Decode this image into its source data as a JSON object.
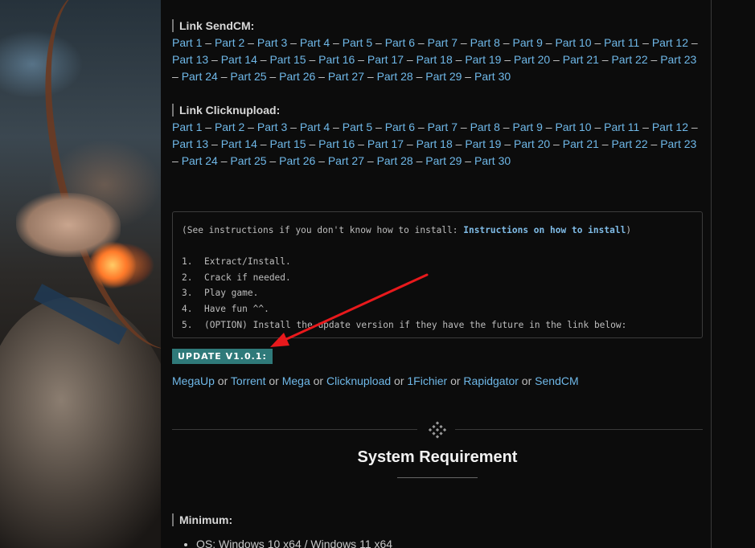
{
  "sendcm": {
    "label": "Link SendCM:",
    "parts": [
      "Part 1",
      "Part 2",
      "Part 3",
      "Part 4",
      "Part 5",
      "Part 6",
      "Part 7",
      "Part 8",
      "Part 9",
      "Part 10",
      "Part 11",
      "Part 12",
      "Part 13",
      "Part 14",
      "Part 15",
      "Part 16",
      "Part 17",
      "Part 18",
      "Part 19",
      "Part 20",
      "Part 21",
      "Part 22",
      "Part 23",
      "Part 24",
      "Part 25",
      "Part 26",
      "Part 27",
      "Part 28",
      "Part 29",
      "Part 30"
    ]
  },
  "clicknupload": {
    "label": "Link Clicknupload:",
    "parts": [
      "Part 1",
      "Part 2",
      "Part 3",
      "Part 4",
      "Part 5",
      "Part 6",
      "Part 7",
      "Part 8",
      "Part 9",
      "Part 10",
      "Part 11",
      "Part 12",
      "Part 13",
      "Part 14",
      "Part 15",
      "Part 16",
      "Part 17",
      "Part 18",
      "Part 19",
      "Part 20",
      "Part 21",
      "Part 22",
      "Part 23",
      "Part 24",
      "Part 25",
      "Part 26",
      "Part 27",
      "Part 28",
      "Part 29",
      "Part 30"
    ]
  },
  "separator": " – ",
  "install": {
    "intro_prefix": "(See instructions if you don't know how to install: ",
    "intro_link": "Instructions on how to install",
    "intro_suffix": ")",
    "steps": [
      {
        "num": "1.",
        "text": "Extract/Install."
      },
      {
        "num": "2.",
        "text": "Crack if needed."
      },
      {
        "num": "3.",
        "text": "Play game."
      },
      {
        "num": "4.",
        "text": "Have fun ^^."
      },
      {
        "num": "5.",
        "text": "(OPTION) Install the update version if they have the future in the link below:"
      }
    ]
  },
  "update": {
    "badge": "UPDATE V1.0.1:",
    "mirrors": [
      "MegaUp",
      "Torrent",
      "Mega",
      "Clicknupload",
      "1Fichier",
      "Rapidgator",
      "SendCM"
    ],
    "joiner": " or "
  },
  "system": {
    "title": "System Requirement",
    "minimum_label": "Minimum:",
    "os": "OS: Windows 10 x64 / Windows 11 x64"
  },
  "colors": {
    "link": "#6fb8e8",
    "badge": "#2f7a7a",
    "arrow": "#e8191c",
    "background": "#0c0c0c"
  },
  "icons": {
    "divider": "diamond-dots-icon",
    "annotation": "red-arrow"
  }
}
